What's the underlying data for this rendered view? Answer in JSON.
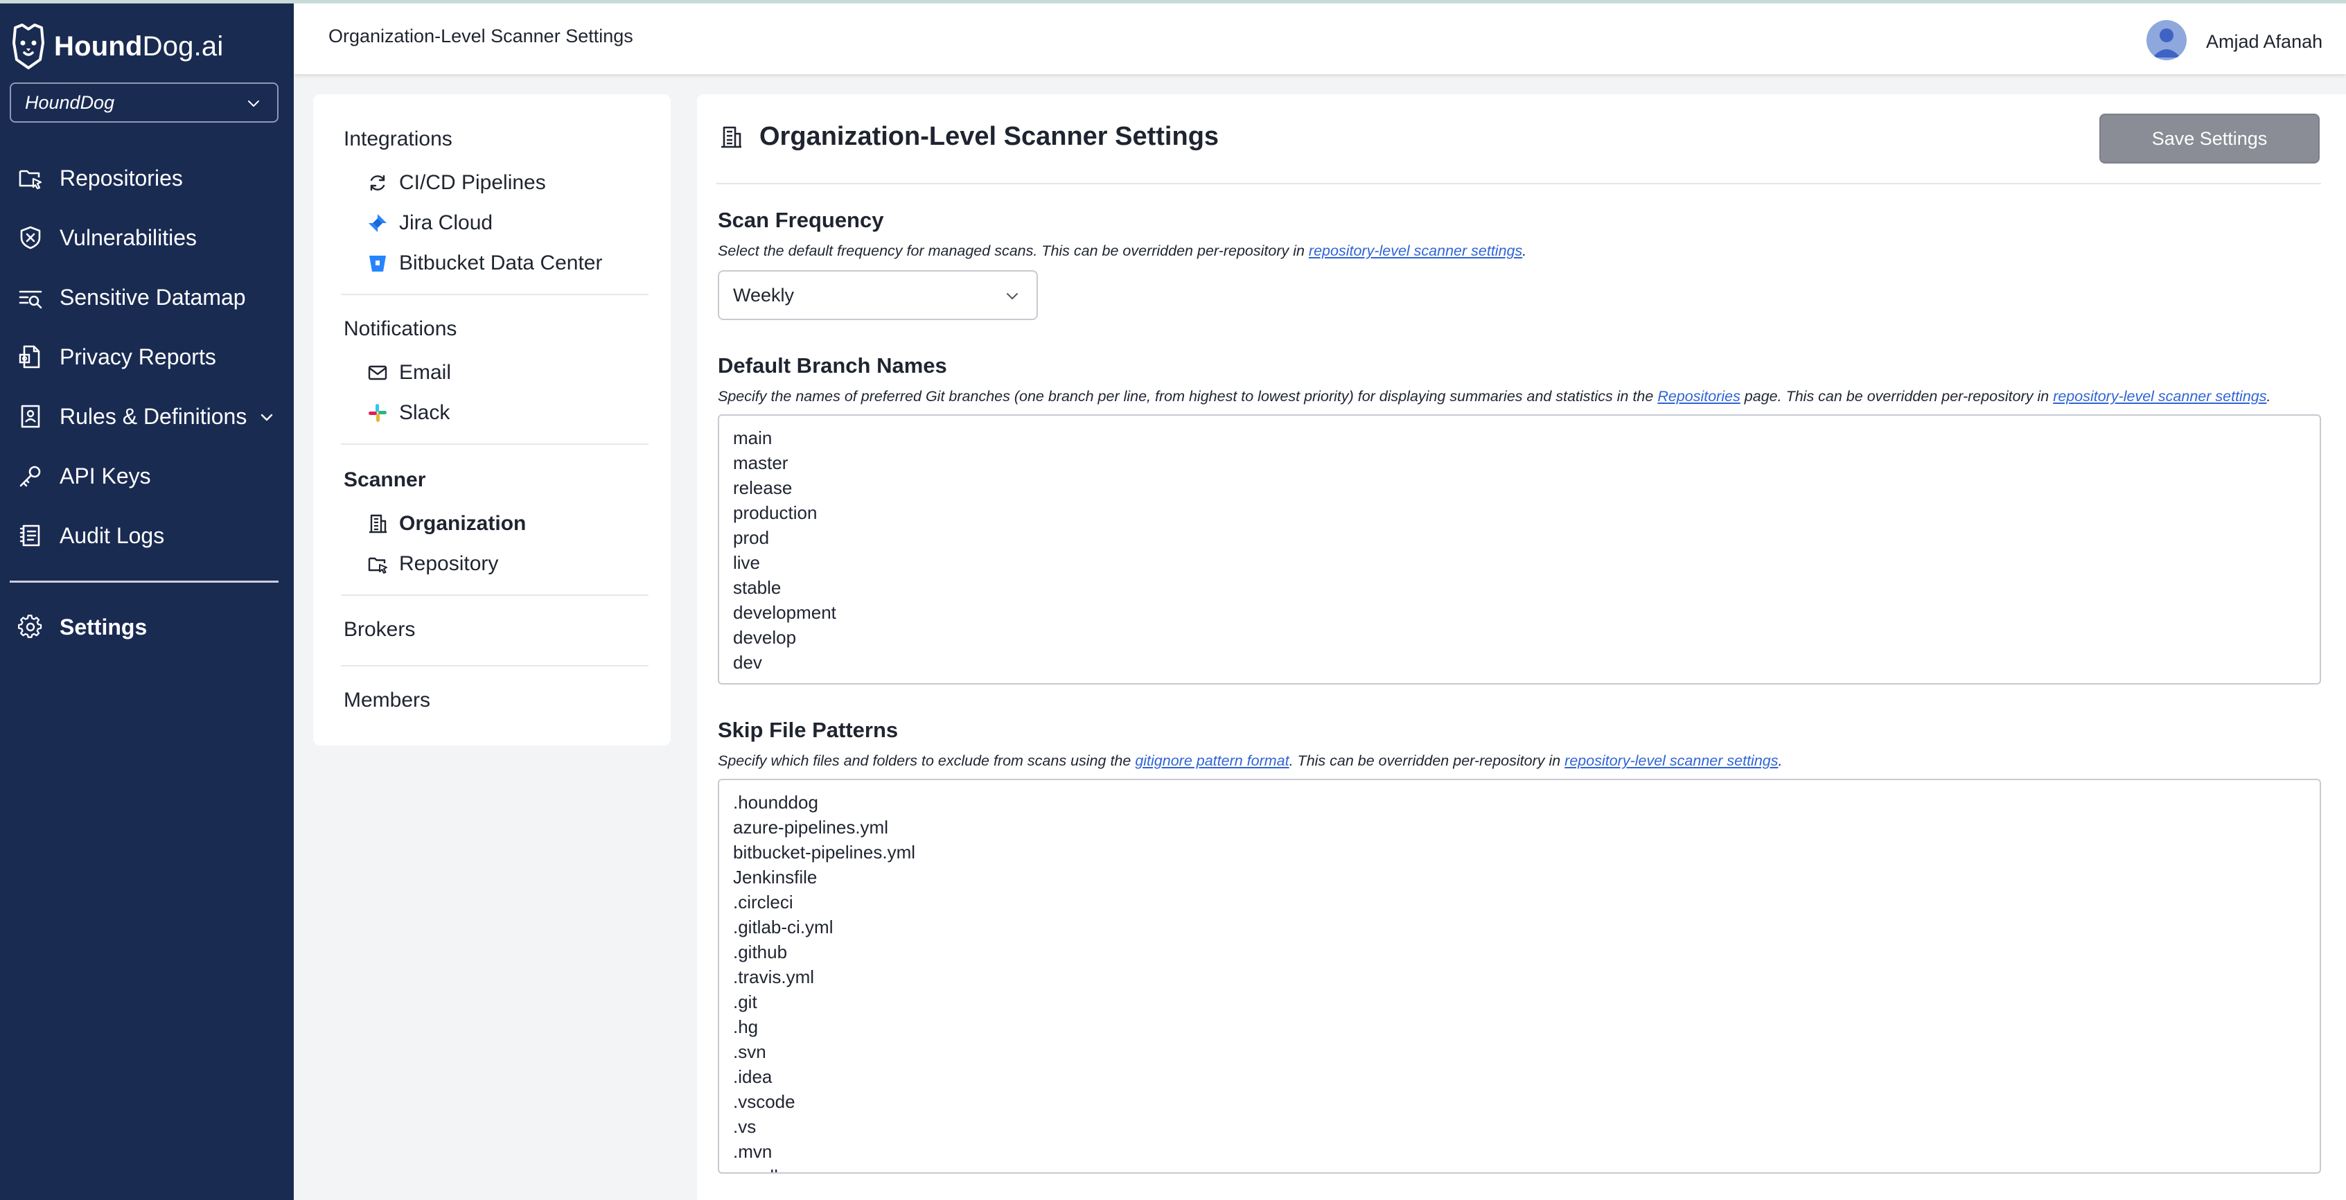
{
  "app": {
    "logo_bold": "Hound",
    "logo_regular": "Dog.ai",
    "org_selector": "HoundDog"
  },
  "nav": {
    "items": [
      {
        "label": "Repositories",
        "icon": "repository-icon"
      },
      {
        "label": "Vulnerabilities",
        "icon": "shield-x-icon"
      },
      {
        "label": "Sensitive Datamap",
        "icon": "datamap-icon"
      },
      {
        "label": "Privacy Reports",
        "icon": "report-icon"
      },
      {
        "label": "Rules & Definitions",
        "icon": "rules-icon"
      },
      {
        "label": "API Keys",
        "icon": "key-icon"
      },
      {
        "label": "Audit Logs",
        "icon": "audit-log-icon"
      }
    ],
    "settings": {
      "label": "Settings",
      "icon": "gear-icon"
    }
  },
  "header": {
    "title": "Organization-Level Scanner Settings",
    "user_name": "Amjad Afanah"
  },
  "submenu": {
    "integrations": {
      "heading": "Integrations",
      "items": [
        "CI/CD Pipelines",
        "Jira Cloud",
        "Bitbucket Data Center"
      ]
    },
    "notifications": {
      "heading": "Notifications",
      "items": [
        "Email",
        "Slack"
      ]
    },
    "scanner": {
      "heading": "Scanner",
      "items": [
        "Organization",
        "Repository"
      ]
    },
    "brokers": "Brokers",
    "members": "Members"
  },
  "main": {
    "title": "Organization-Level Scanner Settings",
    "save_label": "Save Settings",
    "scan_frequency": {
      "title": "Scan Frequency",
      "desc_before": "Select the default frequency for managed scans. This can be overridden per-repository in ",
      "desc_link": "repository-level scanner settings",
      "desc_after": ".",
      "value": "Weekly"
    },
    "branch_names": {
      "title": "Default Branch Names",
      "desc_before": "Specify the names of preferred Git branches (one branch per line, from highest to lowest priority) for displaying summaries and statistics in the ",
      "desc_link1": "Repositories",
      "desc_middle": " page. This can be overridden per-repository in ",
      "desc_link2": "repository-level scanner settings",
      "desc_after": ".",
      "lines": [
        "main",
        "master",
        "release",
        "production",
        "prod",
        "live",
        "stable",
        "development",
        "develop",
        "dev"
      ]
    },
    "skip_patterns": {
      "title": "Skip File Patterns",
      "desc_before": "Specify which files and folders to exclude from scans using the ",
      "desc_link1": "gitignore pattern format",
      "desc_middle": ". This can be overridden per-repository in ",
      "desc_link2": "repository-level scanner settings",
      "desc_after": ".",
      "lines": [
        ".hounddog",
        "azure-pipelines.yml",
        "bitbucket-pipelines.yml",
        "Jenkinsfile",
        ".circleci",
        ".gitlab-ci.yml",
        ".github",
        ".travis.yml",
        ".git",
        ".hg",
        ".svn",
        ".idea",
        ".vscode",
        ".vs",
        ".mvn",
        ".gradle"
      ]
    }
  },
  "colors": {
    "nav_bg": "#1a2b52",
    "link": "#2f63d6",
    "save_button": "#8a8d96"
  }
}
